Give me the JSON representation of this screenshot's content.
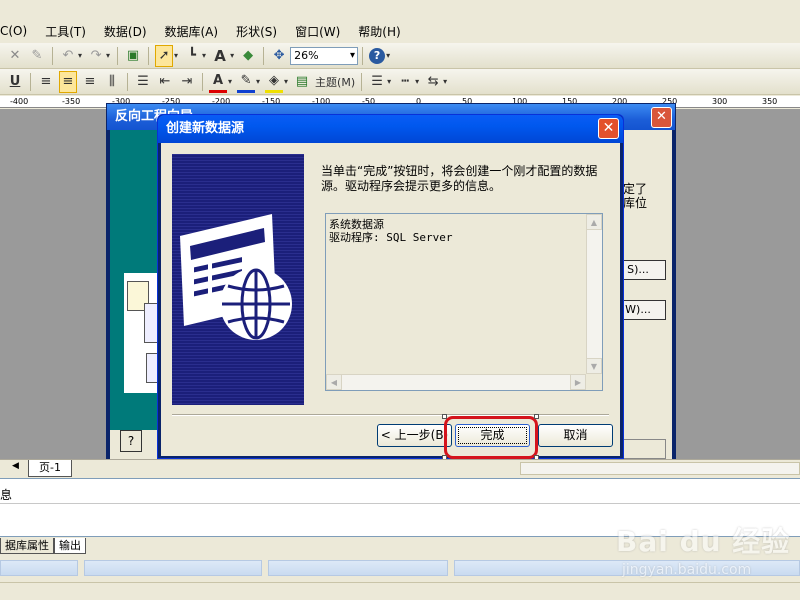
{
  "menubar": {
    "items": [
      "C(O)",
      "工具(T)",
      "数据(D)",
      "数据库(A)",
      "形状(S)",
      "窗口(W)",
      "帮助(H)"
    ]
  },
  "toolbar1": {
    "zoom": "26%"
  },
  "toolbar2": {
    "bold_label": "U",
    "font_a": "A",
    "theme_label": "主题(M)"
  },
  "ruler": {
    "ticks": [
      "-400",
      "-350",
      "-300",
      "-250",
      "-200",
      "-150",
      "-100",
      "-50",
      "0",
      "50",
      "100",
      "150",
      "200",
      "250",
      "300",
      "350"
    ]
  },
  "back_dialog": {
    "title": "反向工程向导",
    "close_glyph": "✕",
    "help_glyph": "?",
    "side_text_1": "定了",
    "side_text_2": "库位",
    "btn1_label": "S)...",
    "btn2_label": "W)..."
  },
  "front_dialog": {
    "title": "创建新数据源",
    "close_glyph": "✕",
    "description": "当单击“完成”按钮时，将会创建一个刚才配置的数据源。驱动程序会提示更多的信息。",
    "info_line1": "系统数据源",
    "info_line2": "驱动程序:  SQL Server",
    "back_button": "< 上一步(B)",
    "finish_button": "完成",
    "cancel_button": "取消"
  },
  "page_tabs": {
    "page1": "页-1"
  },
  "output": {
    "line1": "息"
  },
  "bottom_tabs": {
    "db_props": "据库属性",
    "output": "输出"
  },
  "watermark": {
    "line1": "Bai du 经验",
    "line2": "jingyan.baidu.com"
  },
  "colors": {
    "title_bar": "#0058ee",
    "annotation_red": "#d4141c",
    "wizard_art": "#1b1f7a",
    "back_dialog_panel": "#007a7a"
  }
}
